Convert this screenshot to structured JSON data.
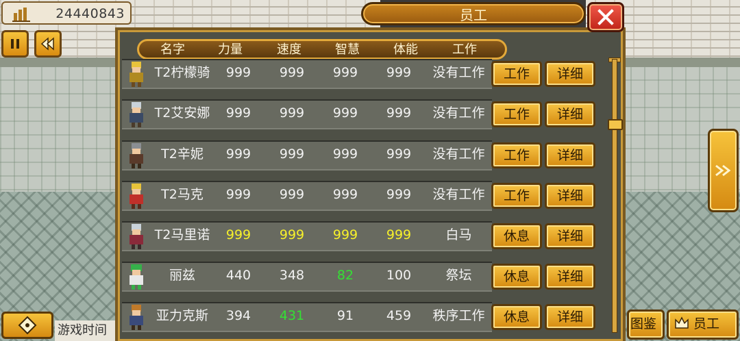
{
  "top": {
    "money": "24440843"
  },
  "title": "员工",
  "headers": [
    "名字",
    "力量",
    "速度",
    "智慧",
    "体能",
    "工作"
  ],
  "employees": [
    {
      "name": "T2柠檬骑",
      "str": "999",
      "spd": "999",
      "int": "999",
      "sta": "999",
      "job": "没有工作",
      "action": "工作",
      "detail": "详细",
      "colors": [
        "#e8c33a",
        "#b08a20"
      ]
    },
    {
      "name": "T2艾安娜",
      "str": "999",
      "spd": "999",
      "int": "999",
      "sta": "999",
      "job": "没有工作",
      "action": "工作",
      "detail": "详细",
      "colors": [
        "#c9d3da",
        "#3a4a66"
      ]
    },
    {
      "name": "T2辛妮",
      "str": "999",
      "spd": "999",
      "int": "999",
      "sta": "999",
      "job": "没有工作",
      "action": "工作",
      "detail": "详细",
      "colors": [
        "#8a8e93",
        "#5a3a2a"
      ]
    },
    {
      "name": "T2马克",
      "str": "999",
      "spd": "999",
      "int": "999",
      "sta": "999",
      "job": "没有工作",
      "action": "工作",
      "detail": "详细",
      "colors": [
        "#e8c33a",
        "#c0302a"
      ]
    },
    {
      "name": "T2马里诺",
      "str": "999",
      "spd": "999",
      "int": "999",
      "sta": "999",
      "job": "白马",
      "action": "休息",
      "detail": "详细",
      "colors": [
        "#c9d3da",
        "#8a2a3a"
      ]
    },
    {
      "name": "丽兹",
      "str": "440",
      "spd": "348",
      "int": "82",
      "sta": "100",
      "job": "祭坛",
      "action": "休息",
      "detail": "详细",
      "colors": [
        "#36b04a",
        "#e8e8e8"
      ]
    },
    {
      "name": "亚力克斯",
      "str": "394",
      "spd": "431",
      "int": "91",
      "sta": "459",
      "job": "秩序工作",
      "action": "休息",
      "detail": "详细",
      "colors": [
        "#c07a2a",
        "#3a4a7a"
      ]
    }
  ],
  "highlight_colors": {
    "yellow": "#f7f12a",
    "green": "#34e034"
  },
  "bottom": {
    "time_label": "游戏时间",
    "book_label": "图鉴",
    "staff_label": "员工"
  }
}
